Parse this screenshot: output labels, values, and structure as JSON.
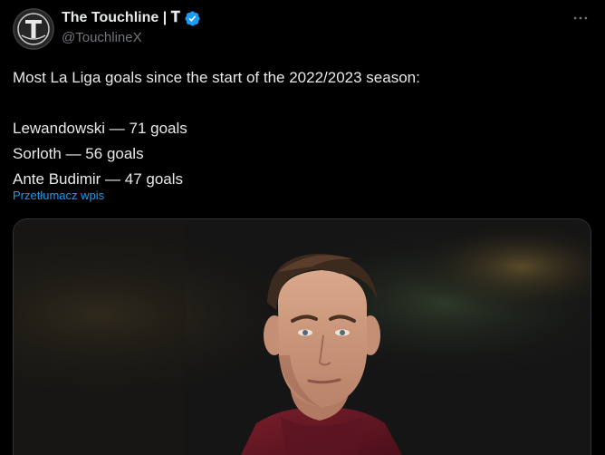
{
  "author": {
    "display_name": "The Touchline | 𝐓",
    "handle": "@TouchlineX",
    "avatar_letter": "T",
    "verified": true,
    "verified_color": "#1d9bf0"
  },
  "tweet": {
    "lines": [
      "Most La Liga goals since the start of the 2022/2023 season:",
      "",
      "Lewandowski — 71 goals",
      "Sorloth — 56 goals",
      "Ante Budimir — 47 goals"
    ],
    "translate_label": "Przetłumacz wpis"
  },
  "icons": {
    "more": "more-icon",
    "verified": "verified-badge-icon"
  },
  "colors": {
    "background": "#000000",
    "text": "#e7e9ea",
    "secondary_text": "#71767b",
    "link": "#1d9bf0",
    "border": "#2f3336"
  }
}
